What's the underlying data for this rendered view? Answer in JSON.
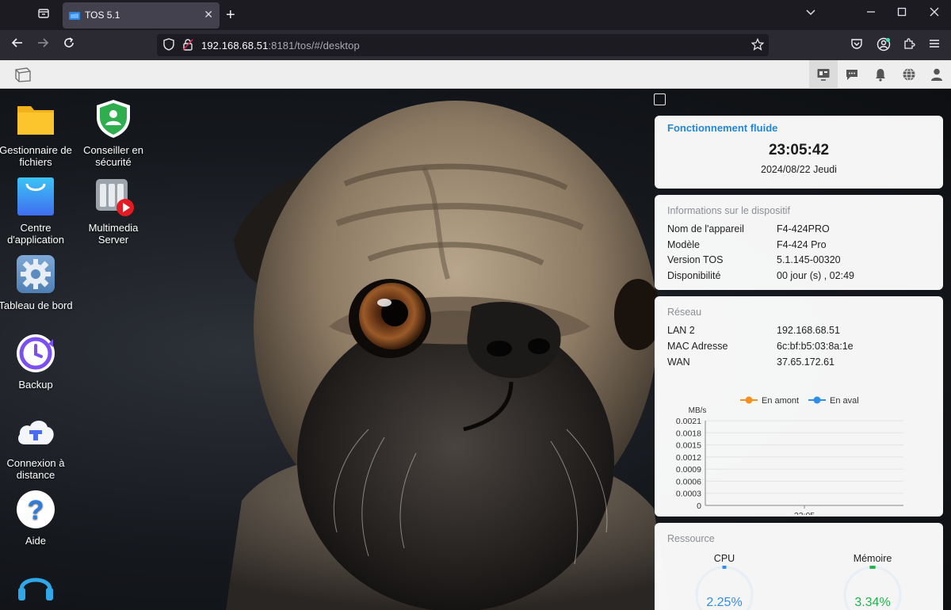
{
  "browser": {
    "tab_title": "TOS 5.1",
    "url_host": "192.168.68.51",
    "url_rest": ":8181/tos/#/desktop"
  },
  "desktop_icons": [
    {
      "label": "Gestionnaire de fichiers",
      "icon": "folder-icon"
    },
    {
      "label": "Centre d'application",
      "icon": "shopping-bag-icon"
    },
    {
      "label": "Tableau de bord",
      "icon": "gear-icon"
    },
    {
      "label": "Backup",
      "icon": "backup-clock-icon"
    },
    {
      "label": "Connexion à distance",
      "icon": "cloud-t-icon"
    },
    {
      "label": "Aide",
      "icon": "help-icon"
    },
    {
      "label": "Conseiller en sécurité",
      "icon": "shield-icon"
    },
    {
      "label": "Multimedia Server",
      "icon": "media-server-icon"
    }
  ],
  "status": {
    "title": "Fonctionnement fluide",
    "time": "23:05:42",
    "date": "2024/08/22 Jeudi"
  },
  "device": {
    "title": "Informations sur le dispositif",
    "rows": [
      {
        "key": "Nom de l'appareil",
        "value": "F4-424PRO"
      },
      {
        "key": "Modèle",
        "value": "F4-424 Pro"
      },
      {
        "key": "Version TOS",
        "value": "5.1.145-00320"
      },
      {
        "key": "Disponibilité",
        "value": "00 jour (s) , 02:49"
      }
    ]
  },
  "network": {
    "title": "Réseau",
    "rows": [
      {
        "key": "LAN 2",
        "value": "192.168.68.51"
      },
      {
        "key": "MAC Adresse",
        "value": "6c:bf:b5:03:8a:1e"
      },
      {
        "key": "WAN",
        "value": "37.65.172.61"
      }
    ]
  },
  "chart_data": {
    "type": "line",
    "ylabel": "MB/s",
    "y_ticks": [
      "0.0021",
      "0.0018",
      "0.0015",
      "0.0012",
      "0.0009",
      "0.0006",
      "0.0003",
      "0"
    ],
    "ylim": [
      0,
      0.0021
    ],
    "x_ticks": [
      "23:05"
    ],
    "series": [
      {
        "name": "En amont",
        "color": "#f5911e",
        "values": []
      },
      {
        "name": "En aval",
        "color": "#2f8ee8",
        "values": []
      }
    ],
    "legend_position": "top"
  },
  "resources": {
    "title": "Ressource",
    "cpu_label": "CPU",
    "cpu_value": "2.25%",
    "cpu_fraction": 0.0225,
    "mem_label": "Mémoire",
    "mem_value": "3.34%",
    "mem_fraction": 0.0334,
    "cpu_color": "#2f8ee8",
    "mem_color": "#22b24c"
  }
}
